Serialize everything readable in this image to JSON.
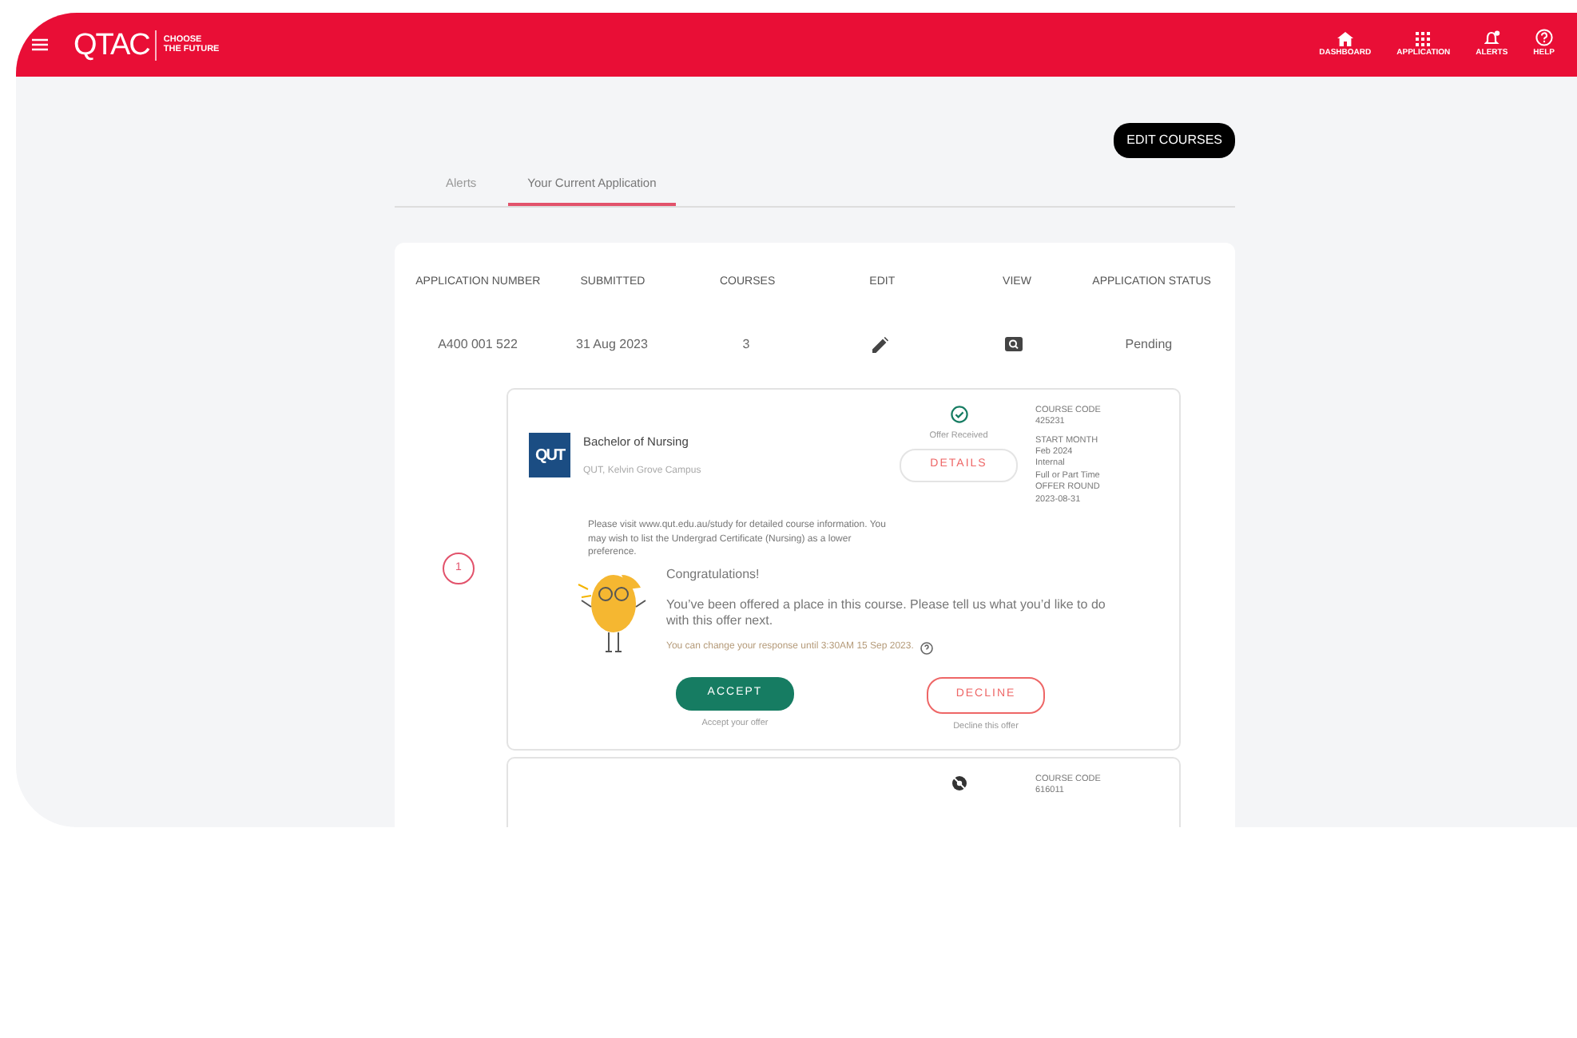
{
  "header": {
    "logo": "QTAC",
    "tagline": [
      "CHOOSE",
      "THE FUTURE"
    ],
    "nav": [
      {
        "label": "DASHBOARD",
        "kind": "home"
      },
      {
        "label": "APPLICATION",
        "kind": "grid"
      },
      {
        "label": "ALERTS",
        "kind": "bell"
      },
      {
        "label": "HELP",
        "kind": "help"
      }
    ]
  },
  "edit_button": "EDIT COURSES",
  "tabs": [
    {
      "label": "Alerts",
      "selected": false
    },
    {
      "label": "Your Current Application",
      "selected": true
    }
  ],
  "table": {
    "columns": [
      "APPLICATION NUMBER",
      "SUBMITTED",
      "COURSES",
      "EDIT",
      "VIEW",
      "APPLICATION STATUS"
    ],
    "rows": [
      {
        "cells": [
          {
            "kind": "text",
            "text": "A400 001 522"
          },
          {
            "kind": "text",
            "text": "31 Aug 2023"
          },
          {
            "kind": "text",
            "text": "3"
          },
          {
            "kind": "edit"
          },
          {
            "kind": "view"
          },
          {
            "kind": "text",
            "text": "Pending"
          }
        ]
      }
    ]
  },
  "preferences": [
    {
      "number": "1",
      "institution_logo": "QUT",
      "title": "Bachelor of Nursing",
      "campus": "QUT, Kelvin Grove Campus",
      "status": {
        "kind": "received",
        "label": "Offer Received"
      },
      "details_button": "DETAILS",
      "info": [
        "COURSE CODE",
        "425231",
        "START MONTH",
        "Feb 2024",
        "Internal",
        "Full or Part Time",
        "OFFER ROUND",
        "2023-08-31"
      ],
      "note": "Please visit www.qut.edu.au/study for detailed course information. You may wish to list the Undergrad Certificate (Nursing) as a lower preference.",
      "offer": {
        "heading": "Congratulations!",
        "message": "You’ve been offered a place in this course. Please tell us what you’d like to do with this offer next.",
        "deadline": "You can change your response until 3:30AM 15 Sep 2023.",
        "accept": {
          "label": "ACCEPT",
          "caption": "Accept your offer"
        },
        "decline": {
          "label": "DECLINE",
          "caption": "Decline this offer"
        }
      }
    },
    {
      "status": {
        "kind": "hidden"
      },
      "info": [
        "COURSE CODE",
        "616011"
      ]
    }
  ]
}
